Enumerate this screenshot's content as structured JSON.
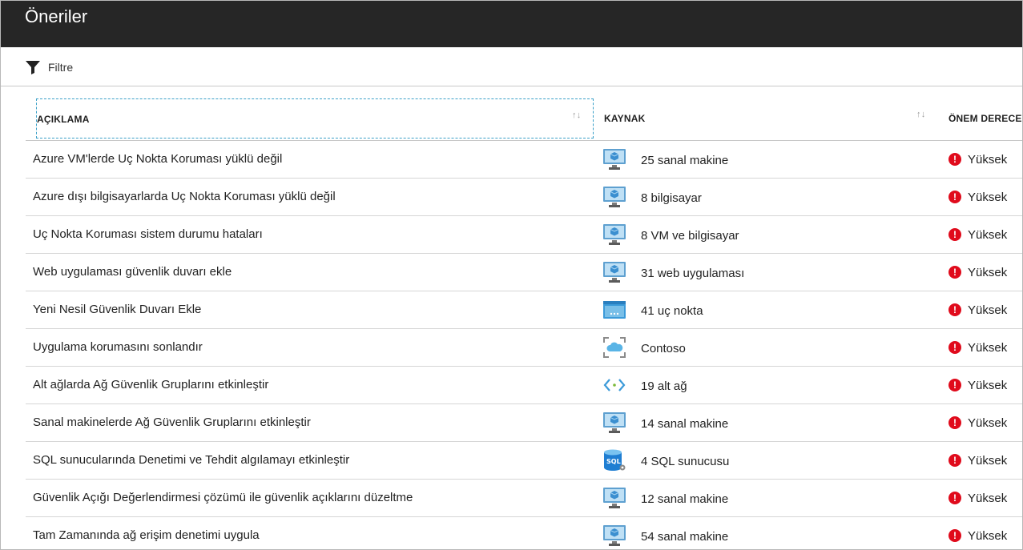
{
  "header": {
    "title": "Öneriler"
  },
  "toolbar": {
    "filter_label": "Filtre",
    "filter_icon": "funnel-icon"
  },
  "table": {
    "columns": {
      "description": "AÇIKLAMA",
      "resource": "KAYNAK",
      "severity": "ÖNEM DERECE"
    },
    "sort_icon": "↑↓",
    "rows": [
      {
        "description": "Azure VM'lerde Uç Nokta Koruması yüklü değil",
        "resource": "25 sanal makine",
        "resource_icon": "vm-icon",
        "severity": "Yüksek"
      },
      {
        "description": "Azure dışı bilgisayarlarda Uç Nokta Koruması yüklü değil",
        "resource": "8 bilgisayar",
        "resource_icon": "vm-icon",
        "severity": "Yüksek"
      },
      {
        "description": "Uç Nokta Koruması sistem durumu hataları",
        "resource": "8 VM ve bilgisayar",
        "resource_icon": "vm-icon",
        "severity": "Yüksek"
      },
      {
        "description": "Web uygulaması güvenlik duvarı ekle",
        "resource": "31 web uygulaması",
        "resource_icon": "vm-icon",
        "severity": "Yüksek"
      },
      {
        "description": "Yeni Nesil Güvenlik Duvarı Ekle",
        "resource": "41 uç nokta",
        "resource_icon": "endpoint-icon",
        "severity": "Yüksek"
      },
      {
        "description": "Uygulama korumasını sonlandır",
        "resource": "Contoso",
        "resource_icon": "cloud-app-icon",
        "severity": "Yüksek"
      },
      {
        "description": "Alt ağlarda Ağ Güvenlik Gruplarını etkinleştir",
        "resource": "19 alt ağ",
        "resource_icon": "subnet-icon",
        "severity": "Yüksek"
      },
      {
        "description": "Sanal makinelerde Ağ Güvenlik Gruplarını etkinleştir",
        "resource": "14 sanal makine",
        "resource_icon": "vm-icon",
        "severity": "Yüksek"
      },
      {
        "description": "SQL sunucularında Denetimi ve Tehdit algılamayı etkinleştir",
        "resource": "4 SQL sunucusu",
        "resource_icon": "sql-server-icon",
        "severity": "Yüksek"
      },
      {
        "description": "Güvenlik Açığı Değerlendirmesi çözümü ile güvenlik açıklarını düzeltme",
        "resource": "12 sanal makine",
        "resource_icon": "vm-icon",
        "severity": "Yüksek"
      },
      {
        "description": "Tam Zamanında ağ erişim denetimi uygula",
        "resource": "54 sanal makine",
        "resource_icon": "vm-icon",
        "severity": "Yüksek"
      }
    ],
    "severity_icon": "!"
  },
  "colors": {
    "titlebar": "#262626",
    "severity_high": "#e00b1c",
    "accent": "#3aa0c8"
  }
}
